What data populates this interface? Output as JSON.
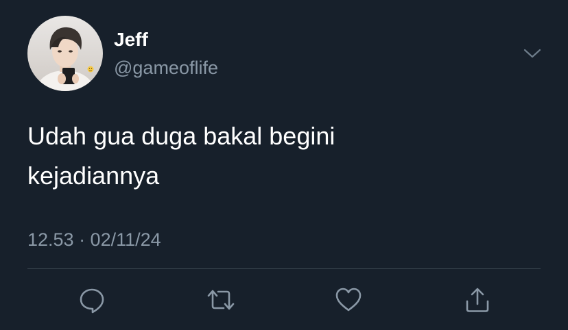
{
  "tweet": {
    "display_name": "Jeff",
    "handle": "@gameoflife",
    "text": "Udah gua duga bakal begini\nkejadiannya",
    "timestamp": "12.53 · 02/11/24"
  },
  "icons": {
    "menu": "chevron-down-icon",
    "reply": "reply-icon",
    "retweet": "retweet-icon",
    "like": "heart-icon",
    "share": "share-icon"
  },
  "colors": {
    "background": "#17202b",
    "primary_text": "#ffffff",
    "secondary_text": "#8a98a6",
    "divider": "#38444d"
  }
}
